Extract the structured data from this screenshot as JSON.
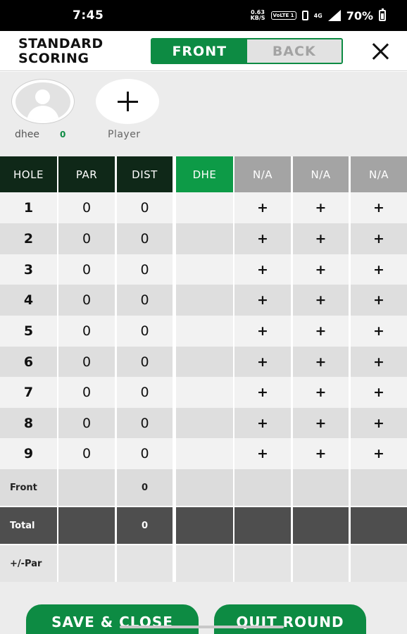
{
  "status": {
    "time": "7:45",
    "net_speed_value": "0.63",
    "net_speed_unit": "KB/S",
    "volte": "VoLTE 1",
    "signal_type": "4G",
    "battery": "70%"
  },
  "header": {
    "title_line1": "STANDARD",
    "title_line2": "SCORING",
    "tab_front": "FRONT",
    "tab_back": "BACK",
    "active_tab": "FRONT"
  },
  "players": {
    "list": [
      {
        "name": "dhee",
        "score": "0"
      }
    ],
    "add_label": "Player"
  },
  "table": {
    "headers": [
      "HOLE",
      "PAR",
      "DIST",
      "DHE",
      "N/A",
      "N/A",
      "N/A"
    ],
    "holes": [
      {
        "hole": "1",
        "par": "0",
        "dist": "0"
      },
      {
        "hole": "2",
        "par": "0",
        "dist": "0"
      },
      {
        "hole": "3",
        "par": "0",
        "dist": "0"
      },
      {
        "hole": "4",
        "par": "0",
        "dist": "0"
      },
      {
        "hole": "5",
        "par": "0",
        "dist": "0"
      },
      {
        "hole": "6",
        "par": "0",
        "dist": "0"
      },
      {
        "hole": "7",
        "par": "0",
        "dist": "0"
      },
      {
        "hole": "8",
        "par": "0",
        "dist": "0"
      },
      {
        "hole": "9",
        "par": "0",
        "dist": "0"
      }
    ],
    "add_score_symbol": "+",
    "front_label": "Front",
    "front_dist": "0",
    "total_label": "Total",
    "total_dist": "0",
    "par_diff_label": "+/-Par"
  },
  "buttons": {
    "save_close": "SAVE & CLOSE",
    "quit_round": "QUIT ROUND"
  },
  "colors": {
    "accent_green": "#0d8b43",
    "header_dark": "#0f2818",
    "header_gray": "#a4a4a4",
    "total_row": "#4e4e4e"
  }
}
